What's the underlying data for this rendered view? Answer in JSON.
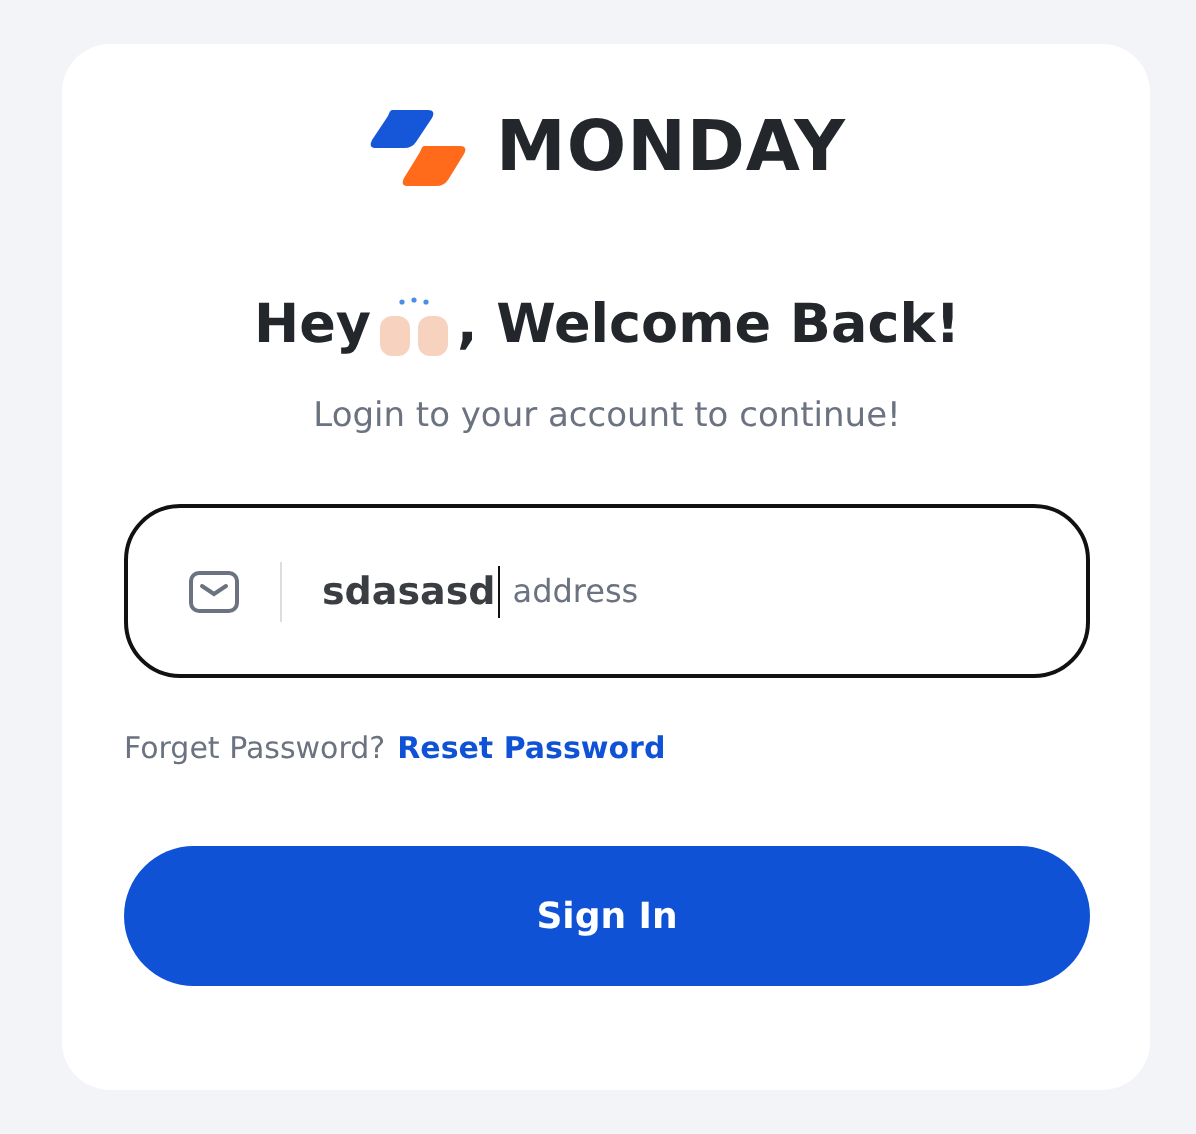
{
  "logo": {
    "text": "MONDAY"
  },
  "heading": {
    "before": "Hey",
    "after": ", Welcome Back!"
  },
  "subtitle": "Login to your account to continue!",
  "email_field": {
    "value": "sdasasd",
    "hint_remnant": "address",
    "focused": true
  },
  "forgot": {
    "text": "Forget Password?",
    "link": "Reset Password"
  },
  "submit": {
    "label": "Sign In"
  }
}
